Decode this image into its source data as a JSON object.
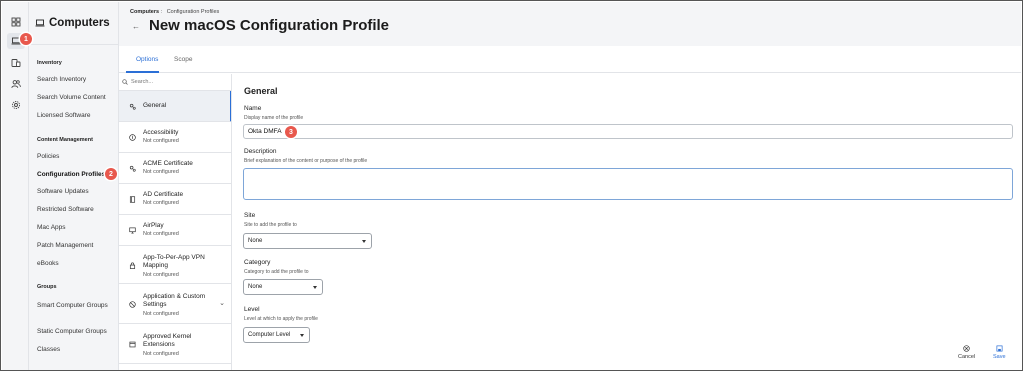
{
  "section_name": "Computers",
  "breadcrumb": {
    "parent": "Computers",
    "separator": ":",
    "current": "Configuration Profiles"
  },
  "page_title": "New macOS Configuration Profile",
  "tabs": [
    {
      "label": "Options"
    },
    {
      "label": "Scope"
    }
  ],
  "sidebar": {
    "sections": [
      {
        "title": "Inventory",
        "items": [
          "Search Inventory",
          "Search Volume Content",
          "Licensed Software"
        ]
      },
      {
        "title": "Content Management",
        "items": [
          "Policies",
          "Configuration Profiles",
          "Software Updates",
          "Restricted Software",
          "Mac Apps",
          "Patch Management",
          "eBooks"
        ]
      },
      {
        "title": "Groups",
        "items": [
          "Smart Computer Groups",
          "Static Computer Groups",
          "Classes"
        ]
      }
    ],
    "active_item": "Configuration Profiles"
  },
  "search": {
    "placeholder": "Search..."
  },
  "payloads": [
    {
      "name": "General",
      "status": "",
      "icon": "gear-icon"
    },
    {
      "name": "Accessibility",
      "status": "Not configured",
      "icon": "accessibility-icon"
    },
    {
      "name": "ACME Certificate",
      "status": "Not configured",
      "icon": "gear-icon"
    },
    {
      "name": "AD Certificate",
      "status": "Not configured",
      "icon": "document-icon"
    },
    {
      "name": "AirPlay",
      "status": "Not configured",
      "icon": "airplay-icon"
    },
    {
      "name": "App-To-Per-App VPN Mapping",
      "status": "Not configured",
      "icon": "lock-icon"
    },
    {
      "name": "Application & Custom Settings",
      "status": "Not configured",
      "icon": "block-icon"
    },
    {
      "name": "Approved Kernel Extensions",
      "status": "Not configured",
      "icon": "extension-icon"
    }
  ],
  "form": {
    "section_title": "General",
    "name": {
      "label": "Name",
      "help": "Display name of the profile",
      "value": "Okta DMFA"
    },
    "description": {
      "label": "Description",
      "help": "Brief explanation of the content or purpose of the profile",
      "value": ""
    },
    "site": {
      "label": "Site",
      "help": "Site to add the profile to",
      "value": "None"
    },
    "category": {
      "label": "Category",
      "help": "Category to add the profile to",
      "value": "None"
    },
    "level": {
      "label": "Level",
      "help": "Level at which to apply the profile",
      "value": "Computer Level"
    }
  },
  "actions": {
    "cancel": "Cancel",
    "save": "Save"
  },
  "step_badges": [
    "1",
    "2",
    "3"
  ],
  "colors": {
    "accent": "#2b6fd6",
    "badge": "#e8584d",
    "sidebar_bg": "#f4f5f7"
  }
}
